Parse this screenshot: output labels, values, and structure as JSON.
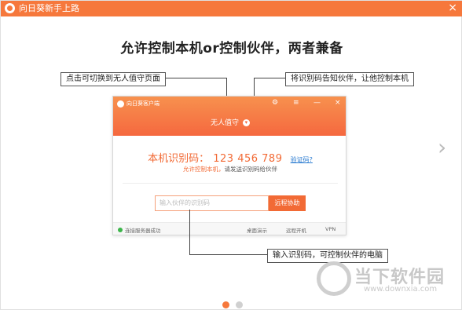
{
  "window": {
    "title": "向日葵新手上路",
    "close_glyph": "×"
  },
  "headline": "允许控制本机or控制伙伴，两者兼备",
  "callouts": {
    "left_top": "点击可切换到无人值守页面",
    "right_top": "将识别码告知伙伴，让他控制本机",
    "bottom": "输入识别码，可控制伙伴的电脑"
  },
  "app": {
    "title": "向日葵客户端",
    "controls": [
      "⚙",
      "≡",
      "—",
      "×"
    ],
    "mode_label": "无人值守",
    "mode_chevron": "▾",
    "id_label": "本机识别码：",
    "id_value": "123 456 789",
    "verify_link": "验证码?",
    "allow_label": "允许控制本机，",
    "allow_hint": "请发送识别码给伙伴",
    "partner_placeholder": "输入伙伴的识别码",
    "remote_button": "远程协助",
    "status": {
      "connected": "连接服务器成功",
      "desktop_demo": "桌面演示",
      "remote_boot": "远程开机",
      "vpn": "VPN"
    }
  },
  "nav": {
    "next_arrow": "›",
    "page_indicator": {
      "current": 1,
      "total": 2
    }
  },
  "watermark": {
    "brand": "当下软件园",
    "url": "www.downxia.com"
  },
  "colors": {
    "accent": "#f6783c",
    "id_orange": "#f26a35",
    "link_blue": "#2a7bd1",
    "status_green": "#3cb54a"
  }
}
